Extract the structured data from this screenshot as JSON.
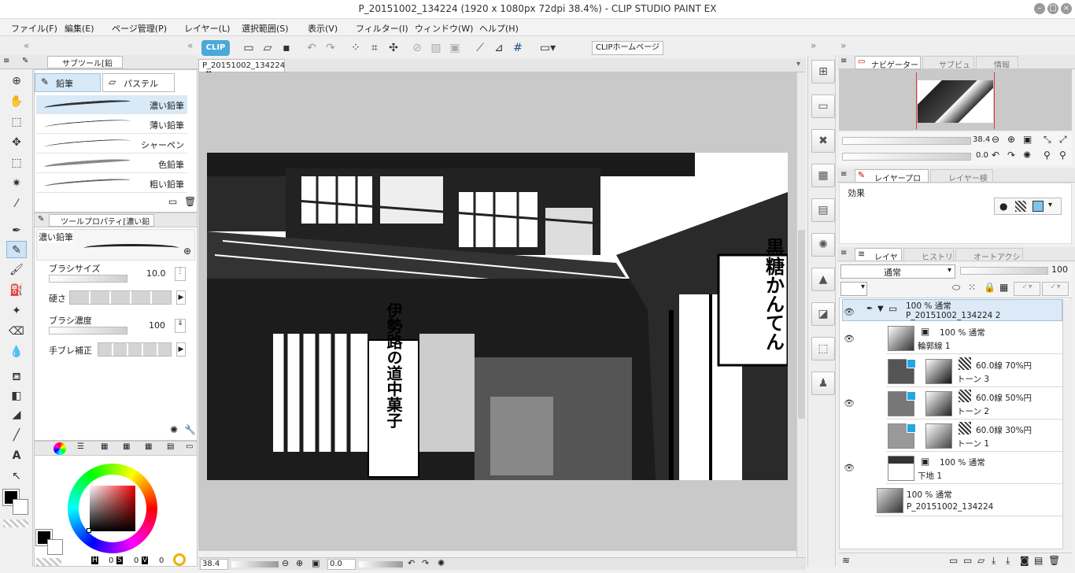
{
  "window": {
    "title": "P_20151002_134224 (1920 x 1080px 72dpi 38.4%)  - CLIP STUDIO PAINT EX"
  },
  "menu": [
    "ファイル(F)",
    "編集(E)",
    "ページ管理(P)",
    "レイヤー(L)",
    "選択範囲(S)",
    "表示(V)",
    "フィルター(I)",
    "ウィンドウ(W)",
    "ヘルプ(H)"
  ],
  "toolbar": {
    "clip_badge": "CLIP",
    "home_label": "CLIPホームページ"
  },
  "canvas": {
    "tab_label": "P_20151002_134224",
    "zoom": "38.4",
    "angle": "0.0"
  },
  "subtool": {
    "title": "サブツール[鉛筆]",
    "tabs": [
      "鉛筆",
      "パステル"
    ],
    "brushes": [
      "濃い鉛筆",
      "薄い鉛筆",
      "シャーペン",
      "色鉛筆",
      "粗い鉛筆"
    ]
  },
  "toolprop": {
    "title": "ツールプロパティ[濃い鉛筆]",
    "preset_name": "濃い鉛筆",
    "brush_size_label": "ブラシサイズ",
    "brush_size_value": "10.0",
    "hardness_label": "硬さ",
    "density_label": "ブラシ濃度",
    "density_value": "100",
    "stabilization_label": "手ブレ補正"
  },
  "color": {
    "h_value": "0",
    "s_value": "0",
    "v_value": "0",
    "h_label": "H",
    "s_label": "S",
    "v_label": "V",
    "accent": "#c23b3b"
  },
  "navigator": {
    "tabs": [
      "ナビゲーター",
      "サブビュー",
      "情報"
    ],
    "zoom_value": "38.4",
    "rotate_value": "0.0"
  },
  "layer_property": {
    "tabs": [
      "レイヤープロパティ",
      "レイヤー検索"
    ],
    "effect_label": "効果"
  },
  "layers_panel": {
    "tabs": [
      "レイヤー",
      "ヒストリー",
      "オートアクション"
    ],
    "blend_mode": "通常",
    "opacity": "100",
    "items": [
      {
        "line1": "100 % 通常",
        "line2": "P_20151002_134224 2"
      },
      {
        "line1": "100 % 通常",
        "line2": "輪郭線 1"
      },
      {
        "line1": "60.0線 70%円",
        "line2": "トーン 3"
      },
      {
        "line1": "60.0線 50%円",
        "line2": "トーン 2"
      },
      {
        "line1": "60.0線 30%円",
        "line2": "トーン 1"
      },
      {
        "line1": "100 % 通常",
        "line2": "下地 1"
      },
      {
        "line1": "100 % 通常",
        "line2": "P_20151002_134224"
      }
    ]
  },
  "sign_text": {
    "banner": "伊勢路の道中菓子",
    "sign_right": "黒糖かんてん"
  }
}
